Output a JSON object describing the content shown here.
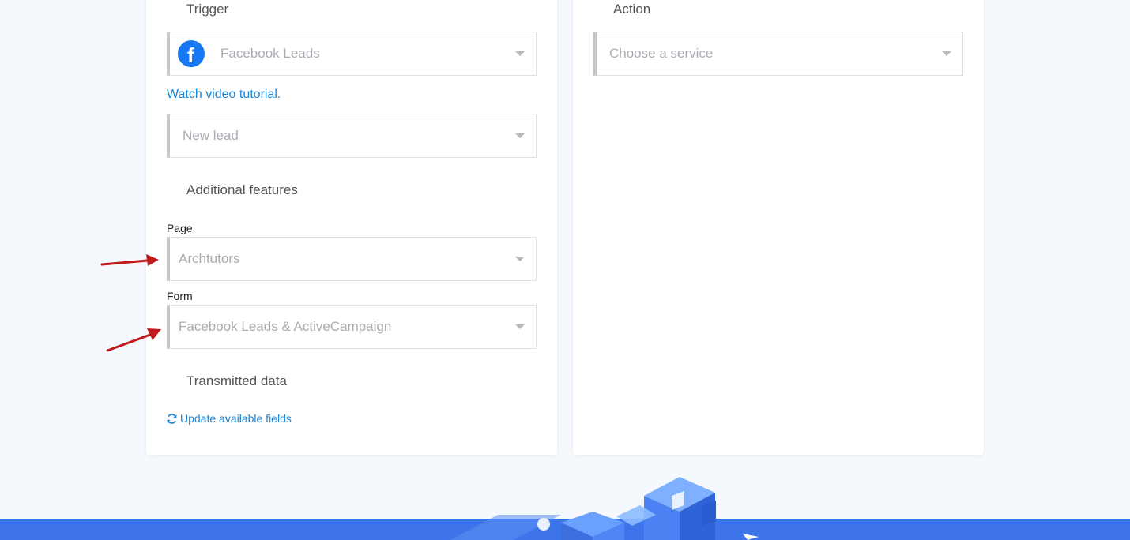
{
  "trigger": {
    "title": "Trigger",
    "service_value": "Facebook Leads",
    "service_icon": "facebook-icon",
    "tutorial_link": "Watch video tutorial.",
    "event_value": "New lead",
    "additional_features_title": "Additional features",
    "page_label": "Page",
    "page_value": "Archtutors",
    "form_label": "Form",
    "form_value": "Facebook Leads & ActiveCampaign",
    "transmitted_data_title": "Transmitted data",
    "update_fields_link": "Update available fields"
  },
  "action": {
    "title": "Action",
    "service_placeholder": "Choose a service"
  },
  "colors": {
    "link": "#1b87d6",
    "facebook": "#1877f2",
    "footer_band": "#3d74ea",
    "annotation_arrow": "#c0191c"
  }
}
